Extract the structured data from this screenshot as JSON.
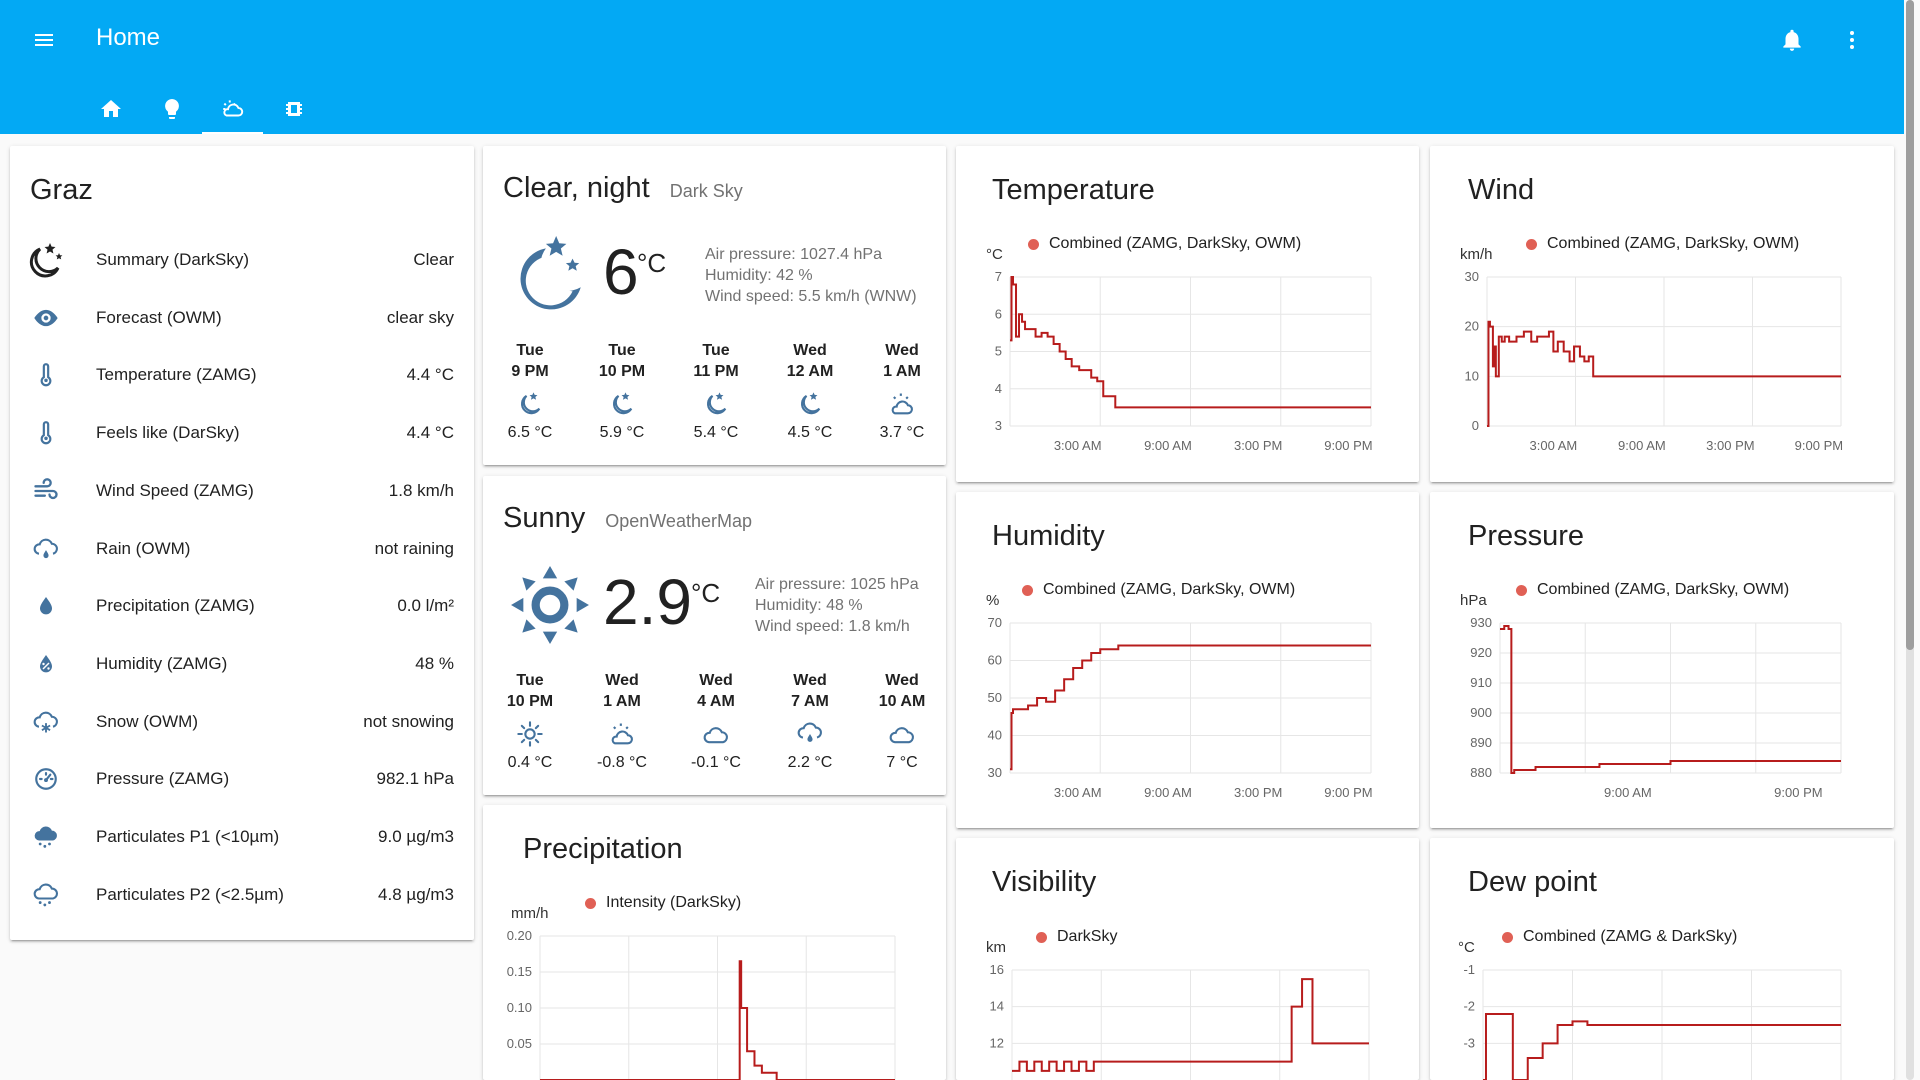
{
  "app": {
    "title": "Home"
  },
  "header": {
    "tabs": [
      {
        "icon": "home-icon"
      },
      {
        "icon": "lightbulb-icon"
      },
      {
        "icon": "weather-partly-cloudy-icon",
        "active": true
      },
      {
        "icon": "memory-chip-icon"
      }
    ]
  },
  "entities_card": {
    "title": "Graz",
    "rows": [
      {
        "icon": "weather-night-icon",
        "name": "Summary (DarkSky)",
        "value": "Clear"
      },
      {
        "icon": "eye-icon",
        "name": "Forecast (OWM)",
        "value": "clear sky"
      },
      {
        "icon": "thermometer-icon",
        "name": "Temperature (ZAMG)",
        "value": "4.4 °C"
      },
      {
        "icon": "thermometer-icon",
        "name": "Feels like (DarSky)",
        "value": "4.4 °C"
      },
      {
        "icon": "wind-icon",
        "name": "Wind Speed (ZAMG)",
        "value": "1.8 km/h"
      },
      {
        "icon": "rain-cloud-icon",
        "name": "Rain (OWM)",
        "value": "not raining"
      },
      {
        "icon": "water-drop-icon",
        "name": "Precipitation (ZAMG)",
        "value": "0.0 l/m²"
      },
      {
        "icon": "humidity-icon",
        "name": "Humidity (ZAMG)",
        "value": "48 %"
      },
      {
        "icon": "snow-cloud-icon",
        "name": "Snow (OWM)",
        "value": "not snowing"
      },
      {
        "icon": "gauge-icon",
        "name": "Pressure (ZAMG)",
        "value": "982.1 hPa"
      },
      {
        "icon": "cloud-dots-icon",
        "name": "Particulates P1 (<10µm)",
        "value": "9.0 µg/m3"
      },
      {
        "icon": "cloud-outline-dots-icon",
        "name": "Particulates P2 (<2.5µm)",
        "value": "4.8 µg/m3"
      }
    ]
  },
  "weather_darksky": {
    "condition": "Clear, night",
    "source": "Dark Sky",
    "icon": "moon-stars-icon",
    "temperature": "6",
    "unit": "°C",
    "attributes": [
      "Air pressure: 1027.4 hPa",
      "Humidity: 42 %",
      "Wind speed: 5.5 km/h (WNW)"
    ],
    "forecast": [
      {
        "day": "Tue",
        "time": "9 PM",
        "icon": "night-icon",
        "temp": "6.5 °C"
      },
      {
        "day": "Tue",
        "time": "10 PM",
        "icon": "night-icon",
        "temp": "5.9 °C"
      },
      {
        "day": "Tue",
        "time": "11 PM",
        "icon": "night-icon",
        "temp": "5.4 °C"
      },
      {
        "day": "Wed",
        "time": "12 AM",
        "icon": "night-icon",
        "temp": "4.5 °C"
      },
      {
        "day": "Wed",
        "time": "1 AM",
        "icon": "partly-cloudy-icon",
        "temp": "3.7 °C"
      }
    ]
  },
  "weather_owm": {
    "condition": "Sunny",
    "source": "OpenWeatherMap",
    "icon": "sun-icon",
    "temperature": "2.9",
    "unit": "°C",
    "attributes": [
      "Air pressure: 1025 hPa",
      "Humidity: 48 %",
      "Wind speed: 1.8 km/h"
    ],
    "forecast": [
      {
        "day": "Tue",
        "time": "10 PM",
        "icon": "sunny-icon",
        "temp": "0.4 °C"
      },
      {
        "day": "Wed",
        "time": "1 AM",
        "icon": "partly-cloudy-icon",
        "temp": "-0.8 °C"
      },
      {
        "day": "Wed",
        "time": "4 AM",
        "icon": "cloudy-icon",
        "temp": "-0.1 °C"
      },
      {
        "day": "Wed",
        "time": "7 AM",
        "icon": "rainy-icon",
        "temp": "2.2 °C"
      },
      {
        "day": "Wed",
        "time": "10 AM",
        "icon": "cloudy-icon",
        "temp": "7 °C"
      }
    ]
  },
  "line_color": "#b71c1c",
  "chart_data": [
    {
      "id": "temperature",
      "type": "line",
      "title": "Temperature",
      "unit": "°C",
      "series": [
        {
          "name": "Combined (ZAMG, DarkSky, OWM)",
          "x": [
            0,
            0.1,
            0.2,
            0.4,
            0.6,
            0.8,
            1.0,
            1.3,
            1.7,
            2.1,
            2.5,
            2.9,
            3.3,
            3.7,
            4.1,
            4.6,
            5.1,
            5.4,
            5.8,
            6.2,
            7,
            10,
            14,
            18,
            24
          ],
          "y": [
            5.3,
            7,
            6.8,
            5.4,
            6,
            5.8,
            5.6,
            5.6,
            5.4,
            5.5,
            5.4,
            5.2,
            5,
            4.8,
            4.6,
            4.5,
            4.5,
            4.3,
            4.2,
            3.8,
            3.5,
            3.5,
            3.5,
            3.5,
            3.5
          ]
        }
      ],
      "x_ticks": [
        "3:00 AM",
        "9:00 AM",
        "3:00 PM",
        "9:00 PM"
      ],
      "ylim": [
        3,
        7
      ],
      "y_ticks": [
        3,
        4,
        5,
        6,
        7
      ]
    },
    {
      "id": "wind",
      "type": "line",
      "title": "Wind",
      "unit": "km/h",
      "series": [
        {
          "name": "Combined (ZAMG, DarkSky, OWM)",
          "x": [
            0,
            0.1,
            0.2,
            0.4,
            0.5,
            0.6,
            0.8,
            1.0,
            1.2,
            1.5,
            2.0,
            2.5,
            3.0,
            3.4,
            3.8,
            4.2,
            4.5,
            4.8,
            5.2,
            5.6,
            5.9,
            6.3,
            6.6,
            6.9,
            7.2,
            8,
            12,
            18,
            24
          ],
          "y": [
            0,
            21,
            20,
            12,
            16,
            10,
            18,
            17,
            18,
            17,
            18,
            19,
            17,
            18,
            18,
            19,
            15,
            17,
            15,
            13,
            16,
            14,
            13,
            14,
            10,
            10,
            10,
            10,
            10
          ]
        }
      ],
      "x_ticks": [
        "3:00 AM",
        "9:00 AM",
        "3:00 PM",
        "9:00 PM"
      ],
      "ylim": [
        0,
        30
      ],
      "y_ticks": [
        0,
        10,
        20,
        30
      ]
    },
    {
      "id": "humidity",
      "type": "line",
      "title": "Humidity",
      "unit": "%",
      "series": [
        {
          "name": "Combined (ZAMG, DarkSky, OWM)",
          "x": [
            0,
            0.1,
            0.2,
            0.6,
            1.2,
            1.8,
            2.4,
            3.0,
            3.6,
            4.2,
            4.8,
            5.4,
            6.0,
            6.6,
            7.2,
            8.5,
            12,
            18,
            24
          ],
          "y": [
            31,
            46,
            47,
            47,
            48,
            50,
            49,
            52,
            55,
            58,
            60,
            62,
            63,
            63,
            64,
            64,
            64,
            64,
            64
          ]
        }
      ],
      "x_ticks": [
        "3:00 AM",
        "9:00 AM",
        "3:00 PM",
        "9:00 PM"
      ],
      "ylim": [
        30,
        70
      ],
      "y_ticks": [
        30,
        40,
        50,
        60,
        70
      ]
    },
    {
      "id": "pressure",
      "type": "line",
      "title": "Pressure",
      "unit": "hPa",
      "series": [
        {
          "name": "Combined (ZAMG, DarkSky, OWM)",
          "x": [
            0,
            0.3,
            0.6,
            0.8,
            1.0,
            2.5,
            7,
            12,
            18,
            24
          ],
          "y": [
            928,
            929,
            928,
            880,
            881,
            882,
            883,
            884,
            884,
            884
          ]
        }
      ],
      "x_ticks": [
        "9:00 AM",
        "9:00 PM"
      ],
      "ylim": [
        880,
        930
      ],
      "y_ticks": [
        880,
        890,
        900,
        910,
        920,
        930
      ]
    },
    {
      "id": "precipitation",
      "type": "line",
      "title": "Precipitation",
      "unit": "mm/h",
      "series": [
        {
          "name": "Intensity (DarkSky)",
          "x": [
            0,
            12,
            13.2,
            13.5,
            13.6,
            14,
            14.5,
            15,
            16,
            24
          ],
          "y": [
            0,
            0,
            0,
            0.165,
            0.1,
            0.04,
            0.02,
            0.01,
            0,
            0
          ]
        }
      ],
      "x_ticks": [],
      "ylim": [
        0,
        0.2
      ],
      "y_ticks": [
        0.05,
        0.1,
        0.15,
        0.2
      ]
    },
    {
      "id": "visibility",
      "type": "line",
      "title": "Visibility",
      "unit": "km",
      "series": [
        {
          "name": "DarkSky",
          "x": [
            0,
            0.5,
            1,
            1.5,
            2,
            2.5,
            3,
            3.5,
            4,
            4.5,
            5,
            5.5,
            6,
            8,
            12,
            16,
            18,
            18.8,
            19.5,
            20.2,
            20.8,
            24
          ],
          "y": [
            10.5,
            11,
            10.5,
            11,
            10.5,
            11,
            10.5,
            11,
            10.5,
            11,
            10.5,
            11,
            11,
            11,
            11,
            11,
            11,
            14,
            15.5,
            12,
            12,
            12
          ]
        }
      ],
      "x_ticks": [],
      "ylim": [
        10,
        16
      ],
      "y_ticks": [
        12,
        14,
        16
      ]
    },
    {
      "id": "dewpoint",
      "type": "line",
      "title": "Dew point",
      "unit": "°C",
      "series": [
        {
          "name": "Combined (ZAMG & DarkSky)",
          "x": [
            0,
            0.2,
            2,
            3,
            4,
            5,
            6,
            7,
            8,
            12,
            18,
            24
          ],
          "y": [
            -4,
            -2.2,
            -4,
            -3.4,
            -3,
            -2.5,
            -2.4,
            -2.5,
            -2.5,
            -2.5,
            -2.5,
            -2.5
          ]
        }
      ],
      "x_ticks": [],
      "ylim": [
        -4,
        -1
      ],
      "y_ticks": [
        -1,
        -2,
        -3
      ]
    }
  ]
}
